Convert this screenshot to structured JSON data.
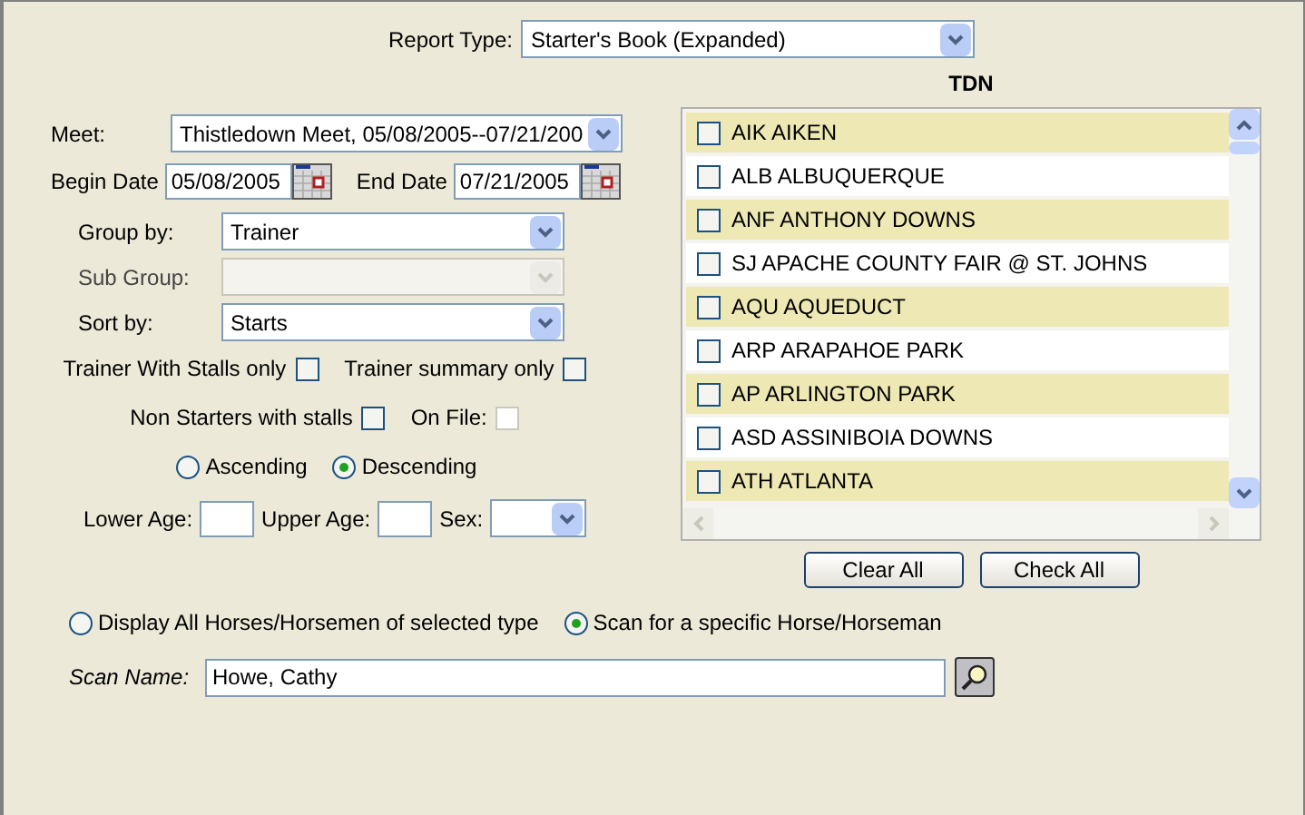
{
  "report_type": {
    "label": "Report Type:",
    "value": "Starter's Book (Expanded)"
  },
  "meet": {
    "label": "Meet:",
    "value": "Thistledown Meet, 05/08/2005--07/21/200"
  },
  "begin_date": {
    "label": "Begin Date",
    "value": "05/08/2005"
  },
  "end_date": {
    "label": "End Date",
    "value": "07/21/2005"
  },
  "group_by": {
    "label": "Group by:",
    "value": "Trainer",
    "disabled": false
  },
  "sub_group": {
    "label": "Sub Group:",
    "disabled": true
  },
  "sort_by": {
    "label": "Sort by:",
    "value": "Starts",
    "disabled": false
  },
  "checkbox_rows": [
    [
      {
        "label": "Trainer With Stalls only",
        "checked": false,
        "disabled": false
      },
      {
        "label": "Trainer summary only",
        "checked": false,
        "disabled": false
      }
    ],
    [
      {
        "label": "Non Starters with stalls",
        "checked": false,
        "disabled": false
      },
      {
        "label": "On File:",
        "checked": false,
        "disabled": true
      }
    ]
  ],
  "order": [
    {
      "label": "Ascending",
      "selected": false
    },
    {
      "label": "Descending",
      "selected": true
    }
  ],
  "ages": {
    "lower_label": "Lower Age:",
    "upper_label": "Upper Age:",
    "sex_label": "Sex:"
  },
  "tracks": {
    "title": "TDN",
    "items": [
      {
        "label": "AIK AIKEN",
        "checked": false
      },
      {
        "label": "ALB ALBUQUERQUE",
        "checked": false
      },
      {
        "label": "ANF ANTHONY DOWNS",
        "checked": false
      },
      {
        "label": "SJ APACHE COUNTY FAIR @ ST. JOHNS",
        "checked": false
      },
      {
        "label": "AQU AQUEDUCT",
        "checked": false
      },
      {
        "label": "ARP ARAPAHOE PARK",
        "checked": false
      },
      {
        "label": "AP ARLINGTON PARK",
        "checked": false
      },
      {
        "label": "ASD ASSINIBOIA DOWNS",
        "checked": false
      },
      {
        "label": "ATH ATLANTA",
        "checked": false
      }
    ],
    "buttons": [
      "Clear All",
      "Check All"
    ]
  },
  "scan_mode": [
    {
      "label": "Display All Horses/Horsemen of selected type",
      "selected": false
    },
    {
      "label": "Scan for a specific Horse/Horseman",
      "selected": true
    }
  ],
  "scan_name": {
    "label": "Scan Name:",
    "value": "Howe, Cathy"
  }
}
